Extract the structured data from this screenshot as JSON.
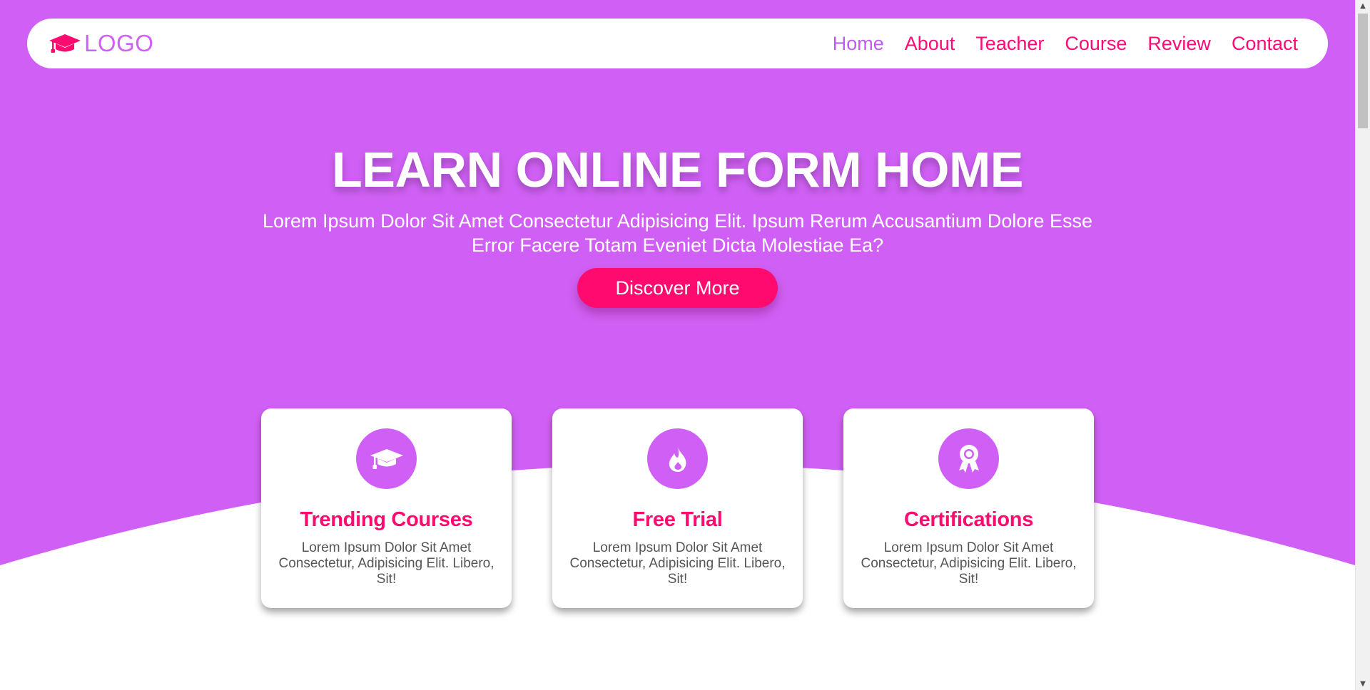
{
  "colors": {
    "hero_purple": "#d060f5",
    "accent_pink": "#ff0a6e",
    "nav_active": "#c05cf5",
    "white": "#ffffff"
  },
  "nav": {
    "logo_icon": "graduation-cap-icon",
    "logo_text": "LOGO",
    "links": [
      {
        "label": "Home",
        "active": true
      },
      {
        "label": "About",
        "active": false
      },
      {
        "label": "Teacher",
        "active": false
      },
      {
        "label": "Course",
        "active": false
      },
      {
        "label": "Review",
        "active": false
      },
      {
        "label": "Contact",
        "active": false
      }
    ]
  },
  "hero": {
    "title": "LEARN ONLINE FORM HOME",
    "subtitle": "Lorem Ipsum Dolor Sit Amet Consectetur Adipisicing Elit. Ipsum Rerum Accusantium Dolore Esse Error Facere Totam Eveniet Dicta Molestiae Ea?",
    "button_label": "Discover More"
  },
  "features": [
    {
      "icon": "graduation-cap-icon",
      "title": "Trending Courses",
      "text": "Lorem Ipsum Dolor Sit Amet Consectetur, Adipisicing Elit. Libero, Sit!"
    },
    {
      "icon": "fire-icon",
      "title": "Free Trial",
      "text": "Lorem Ipsum Dolor Sit Amet Consectetur, Adipisicing Elit. Libero, Sit!"
    },
    {
      "icon": "award-icon",
      "title": "Certifications",
      "text": "Lorem Ipsum Dolor Sit Amet Consectetur, Adipisicing Elit. Libero, Sit!"
    }
  ]
}
